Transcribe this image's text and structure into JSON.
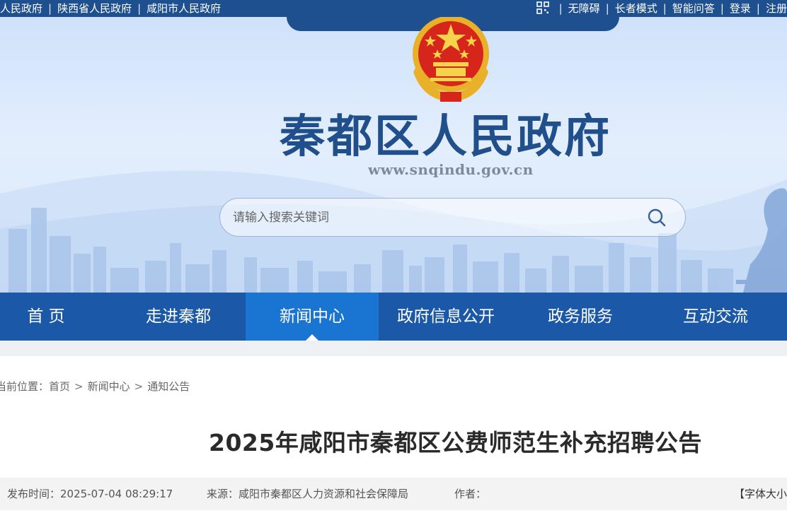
{
  "topbar": {
    "left_links": [
      "人民政府",
      "陕西省人民政府",
      "咸阳市人民政府"
    ],
    "right_links": [
      "无障碍",
      "长者模式",
      "智能问答",
      "登录",
      "注册"
    ],
    "qr_icon": "qr-code-icon"
  },
  "header": {
    "site_title": "秦都区人民政府",
    "site_url": "www.snqindu.gov.cn",
    "emblem_icon": "national-emblem-icon"
  },
  "search": {
    "placeholder": "请输入搜索关键词",
    "icon": "search-icon"
  },
  "nav": {
    "items": [
      {
        "label": "首  页"
      },
      {
        "label": "走进秦都"
      },
      {
        "label": "新闻中心",
        "active": true
      },
      {
        "label": "政府信息公开"
      },
      {
        "label": "政务服务"
      },
      {
        "label": "互动交流"
      }
    ]
  },
  "breadcrumb": {
    "prefix": "当前位置：",
    "items": [
      "首页",
      "新闻中心",
      "通知公告"
    ],
    "separator": ">"
  },
  "article": {
    "title": "2025年咸阳市秦都区公费师范生补充招聘公告",
    "publish_time": "发布时间：2025-07-04 08:29:17",
    "source": "来源：咸阳市秦都区人力资源和社会保障局",
    "author": "作者：",
    "font_size_label": "【字体大小"
  },
  "colors": {
    "topbar_bg": "#1e4f8f",
    "nav_bg": "#1b58a7",
    "nav_active": "#1a75d2",
    "title_blue": "#204f8c"
  }
}
